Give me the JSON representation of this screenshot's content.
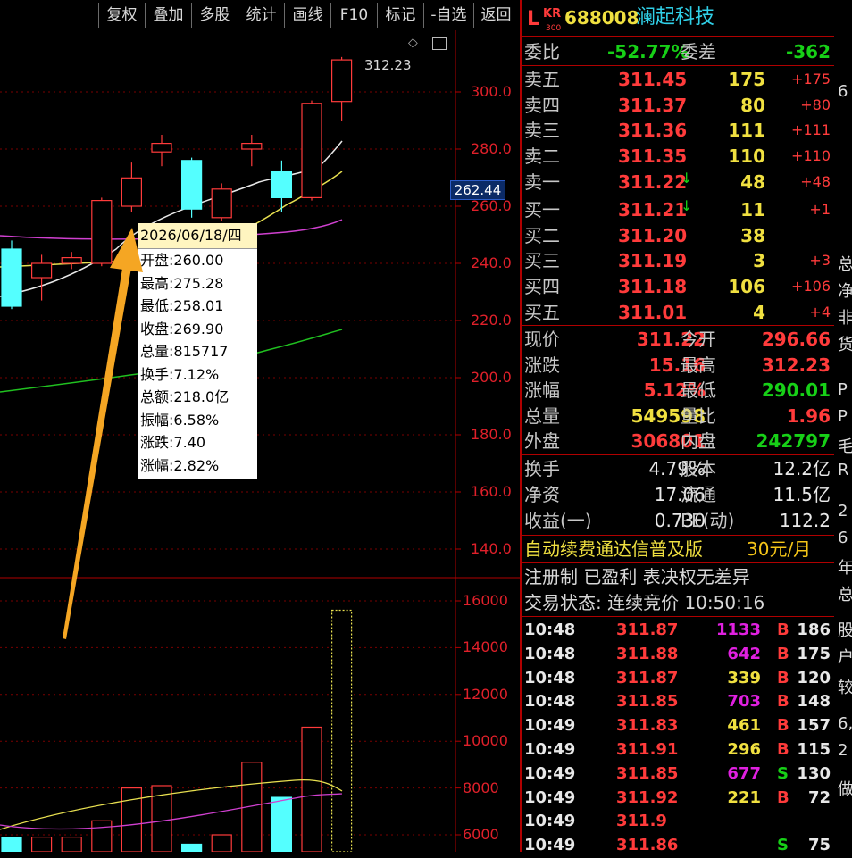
{
  "toolbar": {
    "buttons": [
      "复权",
      "叠加",
      "多股",
      "统计",
      "画线",
      "F10",
      "标记",
      "-自选",
      "返回"
    ]
  },
  "chart": {
    "price_axis": [
      "300.0",
      "280.0",
      "260.0",
      "240.0",
      "220.0",
      "200.0",
      "180.0",
      "160.0",
      "140.0"
    ],
    "current_price_tag": "262.44",
    "high_marker": "312.23",
    "volume_axis": [
      "16000",
      "14000",
      "12000",
      "10000",
      "8000",
      "6000"
    ],
    "candles": [
      {
        "o": 225,
        "c": 245,
        "h": 248,
        "l": 224,
        "up": false
      },
      {
        "o": 235,
        "c": 240,
        "h": 243,
        "l": 227,
        "up": true
      },
      {
        "o": 240,
        "c": 242,
        "h": 244,
        "l": 238,
        "up": true
      },
      {
        "o": 240,
        "c": 262,
        "h": 263,
        "l": 239,
        "up": true
      },
      {
        "o": 260,
        "c": 269.9,
        "h": 275.28,
        "l": 258.01,
        "up": true
      },
      {
        "o": 279,
        "c": 282,
        "h": 285,
        "l": 274,
        "up": true
      },
      {
        "o": 276,
        "c": 259,
        "h": 277,
        "l": 256,
        "up": false
      },
      {
        "o": 256,
        "c": 266,
        "h": 268,
        "l": 255,
        "up": true
      },
      {
        "o": 280,
        "c": 282,
        "h": 285,
        "l": 274,
        "up": true
      },
      {
        "o": 272,
        "c": 263,
        "h": 276,
        "l": 258,
        "up": false
      },
      {
        "o": 263,
        "c": 296,
        "h": 297,
        "l": 262,
        "up": true
      },
      {
        "o": 296.66,
        "c": 311.22,
        "h": 312.23,
        "l": 290.01,
        "up": true
      }
    ],
    "volumes": [
      5900,
      5900,
      5900,
      6600,
      8000,
      8100,
      5600,
      6000,
      9100,
      7600,
      10600,
      15600
    ],
    "volume_last_outline": 15600
  },
  "tooltip": {
    "date": "2026/06/18/四",
    "lines": [
      "开盘:260.00",
      "最高:275.28",
      "最低:258.01",
      "收盘:269.90",
      "总量:815717",
      "换手:7.12%",
      "总额:218.0亿",
      "振幅:6.58%",
      "涨跌:7.40",
      "涨幅:2.82%"
    ]
  },
  "quote": {
    "badge_top": "KR",
    "badge_bottom": "300",
    "badge_letter": "L",
    "code": "688008",
    "name": "澜起科技",
    "weibi_label": "委比",
    "weibi_value": "-52.77%",
    "weicha_label": "委差",
    "weicha_value": "-362",
    "asks": [
      {
        "label": "卖五",
        "price": "311.45",
        "vol": "175",
        "chg": "+175"
      },
      {
        "label": "卖四",
        "price": "311.37",
        "vol": "80",
        "chg": "+80"
      },
      {
        "label": "卖三",
        "price": "311.36",
        "vol": "111",
        "chg": "+111"
      },
      {
        "label": "卖二",
        "price": "311.35",
        "vol": "110",
        "chg": "+110"
      },
      {
        "label": "卖一",
        "price": "311.22",
        "vol": "48",
        "chg": "+48"
      }
    ],
    "bids": [
      {
        "label": "买一",
        "price": "311.21",
        "vol": "11",
        "chg": "+1"
      },
      {
        "label": "买二",
        "price": "311.20",
        "vol": "38",
        "chg": ""
      },
      {
        "label": "买三",
        "price": "311.19",
        "vol": "3",
        "chg": "+3"
      },
      {
        "label": "买四",
        "price": "311.18",
        "vol": "106",
        "chg": "+106"
      },
      {
        "label": "买五",
        "price": "311.01",
        "vol": "4",
        "chg": "+4"
      }
    ],
    "stats": [
      {
        "l1": "现价",
        "v1": "311.22",
        "l2": "今开",
        "v2": "296.66",
        "c1": "red",
        "c2": "red"
      },
      {
        "l1": "涨跌",
        "v1": "15.16",
        "l2": "最高",
        "v2": "312.23",
        "c1": "red",
        "c2": "red"
      },
      {
        "l1": "涨幅",
        "v1": "5.12%",
        "l2": "最低",
        "v2": "290.01",
        "c1": "red",
        "c2": "green"
      },
      {
        "l1": "总量",
        "v1": "549598",
        "l2": "量比",
        "v2": "1.96",
        "c1": "yellow",
        "c2": "red"
      },
      {
        "l1": "外盘",
        "v1": "306801",
        "l2": "内盘",
        "v2": "242797",
        "c1": "red",
        "c2": "green"
      }
    ],
    "stats2": [
      {
        "l1": "换手",
        "v1": "4.79%",
        "l2": "股本",
        "v2": "12.2亿"
      },
      {
        "l1": "净资",
        "v1": "17.06",
        "l2": "流通",
        "v2": "11.5亿"
      },
      {
        "l1": "收益(一)",
        "v1": "0.730",
        "l2": "PE(动)",
        "v2": "112.2"
      }
    ],
    "promo": "自动续费通达信普及版",
    "promo_price": "30元/月",
    "tags": "注册制 已盈利 表决权无差异",
    "trade_status": "交易状态: 连续竞价 10:50:16",
    "ticks": [
      {
        "t": "10:48",
        "p": "311.87",
        "v": "1133",
        "s": "B",
        "n": "186",
        "vc": "magenta"
      },
      {
        "t": "10:48",
        "p": "311.88",
        "v": "642",
        "s": "B",
        "n": "175",
        "vc": "magenta"
      },
      {
        "t": "10:48",
        "p": "311.87",
        "v": "339",
        "s": "B",
        "n": "120",
        "vc": "yellow"
      },
      {
        "t": "10:48",
        "p": "311.85",
        "v": "703",
        "s": "B",
        "n": "148",
        "vc": "magenta"
      },
      {
        "t": "10:49",
        "p": "311.83",
        "v": "461",
        "s": "B",
        "n": "157",
        "vc": "yellow"
      },
      {
        "t": "10:49",
        "p": "311.91",
        "v": "296",
        "s": "B",
        "n": "115",
        "vc": "yellow"
      },
      {
        "t": "10:49",
        "p": "311.85",
        "v": "677",
        "s": "S",
        "n": "130",
        "vc": "magenta"
      },
      {
        "t": "10:49",
        "p": "311.92",
        "v": "221",
        "s": "B",
        "n": "72",
        "vc": "yellow"
      },
      {
        "t": "10:49",
        "p": "311.9",
        "v": "",
        "s": "",
        "n": "",
        "vc": "yellow"
      },
      {
        "t": "10:49",
        "p": "311.86",
        "v": "",
        "s": "S",
        "n": "75",
        "vc": "yellow"
      }
    ]
  },
  "strip": [
    "6",
    "总",
    "净",
    "非",
    "货",
    "P",
    "P",
    "毛",
    "R",
    "2",
    "6",
    "年",
    "总",
    "股",
    "户",
    "较",
    "6,",
    "2",
    "做"
  ]
}
